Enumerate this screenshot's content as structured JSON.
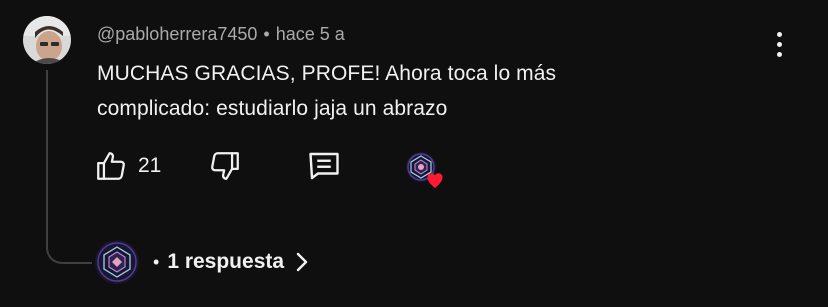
{
  "comment": {
    "author": "@pabloherrera7450",
    "separator": "•",
    "timestamp": "hace 5 a",
    "text_line1": "MUCHAS GRACIAS, PROFE!  Ahora toca lo más",
    "text_line2": "complicado: estudiarlo jaja un abrazo",
    "like_count": "21"
  },
  "replies": {
    "separator": "•",
    "label": "1 respuesta"
  },
  "icons": {
    "like": "thumb-up-icon",
    "dislike": "thumb-down-icon",
    "reply": "comment-bubble-icon",
    "more": "more-vertical-icon",
    "heart": "heart-icon",
    "chevron": "chevron-right-icon"
  },
  "colors": {
    "background": "#0f0f0f",
    "heart": "#ff1a33",
    "muted_text": "#aaaaaa"
  }
}
